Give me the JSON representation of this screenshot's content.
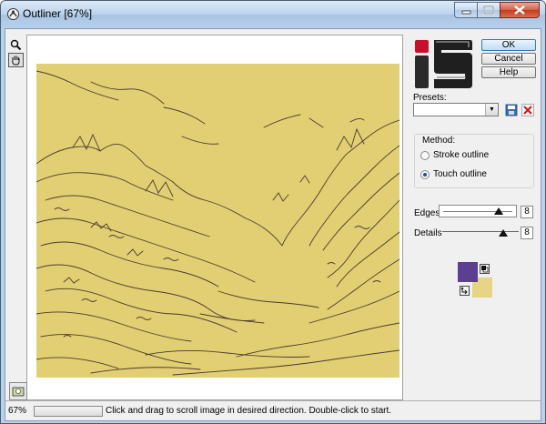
{
  "window": {
    "title": "Outliner [67%]",
    "controls": [
      "minimize",
      "maximize",
      "close"
    ]
  },
  "toolbar": {
    "tools": [
      {
        "name": "zoom",
        "icon": "magnifier-icon"
      },
      {
        "name": "pan",
        "icon": "hand-icon"
      }
    ]
  },
  "preview": {
    "image_color": "#e3cf73",
    "line_color": "#4a3b2e"
  },
  "buttons": {
    "ok": "OK",
    "cancel": "Cancel",
    "help": "Help"
  },
  "presets": {
    "label": "Presets:",
    "value": "",
    "save_icon": "save-icon",
    "delete_icon": "delete-icon"
  },
  "method": {
    "legend": "Method:",
    "options": [
      "Stroke outline",
      "Touch outline"
    ],
    "selected": "Touch outline"
  },
  "sliders": [
    {
      "label": "Edges",
      "value": "8",
      "level": 0.8
    },
    {
      "label": "Details",
      "value": "8",
      "level": 0.8
    }
  ],
  "colors": {
    "foreground": "#5b3f91",
    "background": "#e6d584"
  },
  "status": {
    "zoom": "67%",
    "message": "Click and drag to scroll image in desired direction. Double-click to start."
  }
}
